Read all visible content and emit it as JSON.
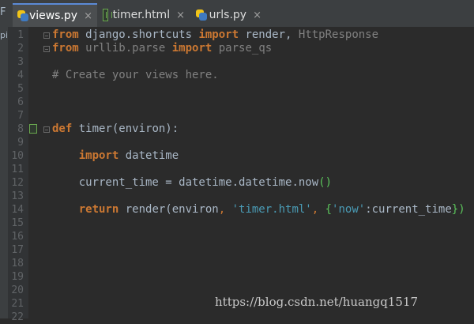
{
  "tabs": [
    {
      "label": "views.py",
      "icon": "python-file-icon",
      "active": true
    },
    {
      "label": "timer.html",
      "icon": "html-file-icon",
      "active": false
    },
    {
      "label": "urls.py",
      "icon": "python-file-icon",
      "active": false
    }
  ],
  "close_glyph": "×",
  "left_strip": {
    "top": "F",
    "side": "pi"
  },
  "line_numbers": [
    "1",
    "2",
    "3",
    "4",
    "5",
    "6",
    "7",
    "8",
    "9",
    "10",
    "11",
    "12",
    "13",
    "14",
    "15",
    "16",
    "17",
    "18",
    "19",
    "20",
    "21",
    "22"
  ],
  "code": {
    "l1": {
      "kw_from": "from",
      "mod": " django.shortcuts ",
      "kw_import": "import",
      "name1": " render",
      "comma": ", ",
      "name2": "HttpResponse"
    },
    "l2": {
      "kw_from": "from",
      "mod": " urllib.parse ",
      "kw_import": "import",
      "name": " parse_qs"
    },
    "l4": {
      "comment": "# Create your views here."
    },
    "l8": {
      "kw_def": "def",
      "fn": " timer",
      "params": "(environ):"
    },
    "l10": {
      "indent": "    ",
      "kw_import": "import",
      "name": " datetime"
    },
    "l12": {
      "indent": "    ",
      "text": "current_time = datetime.datetime.now",
      "parens": "()"
    },
    "l14": {
      "indent": "    ",
      "kw_return": "return",
      "call": " render(environ",
      "comma1": ", ",
      "str1": "'timer.html'",
      "comma2": ", ",
      "brace_open": "{",
      "str2": "'now'",
      "rest": ":current_time",
      "brace_close": "})"
    }
  },
  "watermark": "https://blog.csdn.net/huangq1517",
  "colors": {
    "background": "#2b2b2b",
    "keyword": "#cc7832",
    "string": "#6a8759",
    "comment": "#808080",
    "text": "#a9b7c6"
  }
}
